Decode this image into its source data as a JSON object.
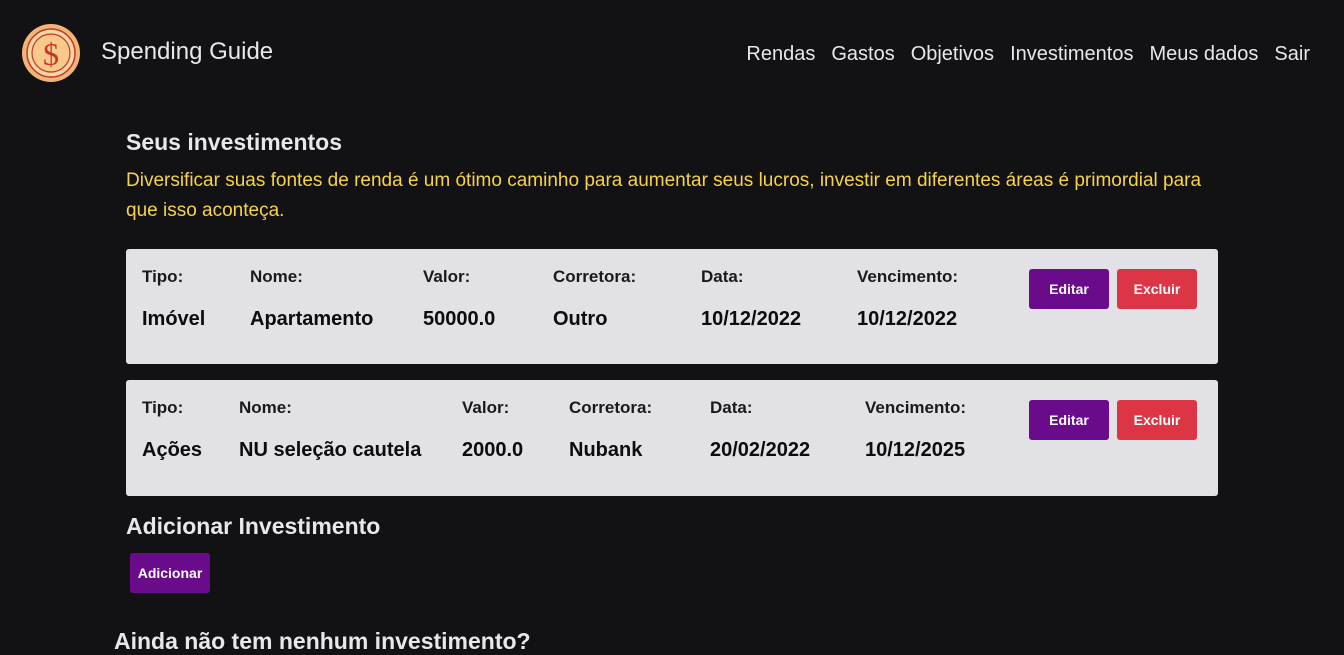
{
  "header": {
    "brand": "Spending Guide",
    "logo_icon": "dollar-coin-icon",
    "nav": [
      "Rendas",
      "Gastos",
      "Objetivos",
      "Investimentos",
      "Meus dados",
      "Sair"
    ]
  },
  "main": {
    "title": "Seus investimentos",
    "subtitle": "Diversificar suas fontes de renda é um ótimo caminho para aumentar seus lucros, investir em diferentes áreas é primordial para que isso aconteça.",
    "labels": {
      "tipo": "Tipo:",
      "nome": "Nome:",
      "valor": "Valor:",
      "corretora": "Corretora:",
      "data": "Data:",
      "vencimento": "Vencimento:"
    },
    "edit_label": "Editar",
    "delete_label": "Excluir",
    "investments": [
      {
        "tipo": "Imóvel",
        "nome": "Apartamento",
        "valor": "50000.0",
        "corretora": "Outro",
        "data": "10/12/2022",
        "vencimento": "10/12/2022"
      },
      {
        "tipo": "Ações",
        "nome": "NU seleção cautela",
        "valor": "2000.0",
        "corretora": "Nubank",
        "data": "20/02/2022",
        "vencimento": "10/12/2025"
      }
    ],
    "add_title": "Adicionar Investimento",
    "add_label": "Adicionar",
    "empty_title": "Ainda não tem nenhum investimento?"
  },
  "colors": {
    "background": "#121214",
    "accent_purple": "#6a0b8c",
    "danger_red": "#dc3545",
    "highlight_yellow": "#f6d34a",
    "card_bg": "#e1e1e6"
  }
}
